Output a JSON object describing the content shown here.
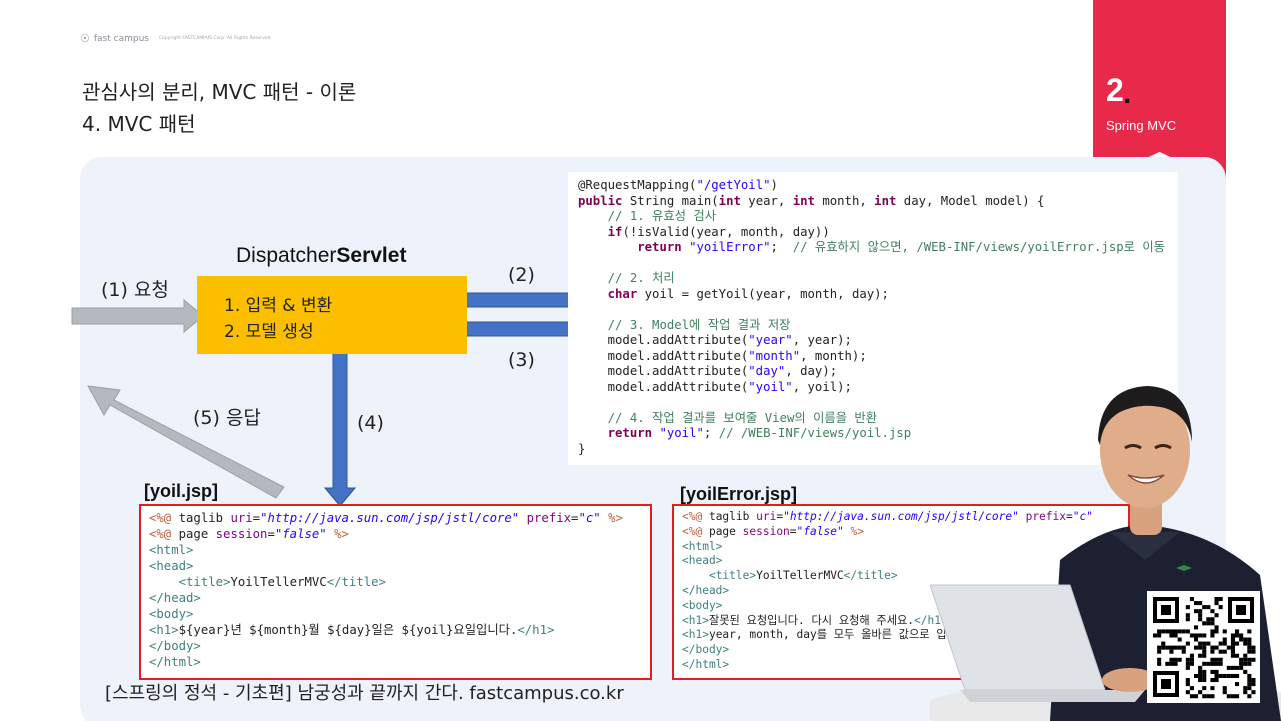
{
  "header": {
    "brand": "fast campus",
    "copyright": "Copyright FASTCAMPUS Corp. All Rights Reserved"
  },
  "slide": {
    "title_line1": "관심사의 분리, MVC 패턴 - 이론",
    "title_line2": "4. MVC 패턴"
  },
  "chapter": {
    "number": "2",
    "dot": ".",
    "label": "Spring MVC"
  },
  "diagram": {
    "servlet_title_plain": "Dispatcher",
    "servlet_title_bold": "Servlet",
    "box_line1": "1. 입력 & 변환",
    "box_line2": "2. 모델 생성",
    "step1": "(1) 요청",
    "step2": "(2)",
    "step3": "(3)",
    "step4": "(4)",
    "step5": "(5) 응답"
  },
  "controller_code": [
    "@RequestMapping(\"/getYoil\")",
    "public String main(int year, int month, int day, Model model) {",
    "    // 1. 유효성 검사",
    "    if(!isValid(year, month, day))",
    "        return \"yoilError\";  // 유효하지 않으면, /WEB-INF/views/yoilError.jsp로 이동",
    "",
    "    // 2. 처리",
    "    char yoil = getYoil(year, month, day);",
    "",
    "    // 3. Model에 작업 결과 저장",
    "    model.addAttribute(\"year\", year);",
    "    model.addAttribute(\"month\", month);",
    "    model.addAttribute(\"day\", day);",
    "    model.addAttribute(\"yoil\", yoil);",
    "",
    "    // 4. 작업 결과를 보여줄 View의 이름을 반환",
    "    return \"yoil\"; // /WEB-INF/views/yoil.jsp",
    "}"
  ],
  "yoil_jsp": {
    "label": "[yoil.jsp]",
    "lines": [
      "<%@ taglib uri=\"http://java.sun.com/jsp/jstl/core\" prefix=\"c\" %>",
      "<%@ page session=\"false\" %>",
      "<html>",
      "<head>",
      "    <title>YoilTellerMVC</title>",
      "</head>",
      "<body>",
      "<h1>${year}년 ${month}월 ${day}일은 ${yoil}요일입니다.</h1>",
      "</body>",
      "</html>"
    ]
  },
  "yoilerror_jsp": {
    "label": "[yoilError.jsp]",
    "lines": [
      "<%@ taglib uri=\"http://java.sun.com/jsp/jstl/core\" prefix=\"c\"",
      "<%@ page session=\"false\" %>",
      "<html>",
      "<head>",
      "    <title>YoilTellerMVC</title>",
      "</head>",
      "<body>",
      "<h1>잘못된 요청입니다. 다시 요청해 주세요.</h1",
      "<h1>year, month, day를 모두 올바른 값으로 입",
      "</body>",
      "</html>"
    ]
  },
  "footer": {
    "text": "[스프링의 정석 - 기초편] 남궁성과 끝까지 간다.  fastcampus.co.kr"
  },
  "colors": {
    "accent_red": "#e8294a",
    "servlet_box": "#fbbf00",
    "arrow_blue": "#4472c4",
    "arrow_gray": "#b4b8bf",
    "jsp_border": "#e02020",
    "panel_bg": "#eef2fb"
  }
}
